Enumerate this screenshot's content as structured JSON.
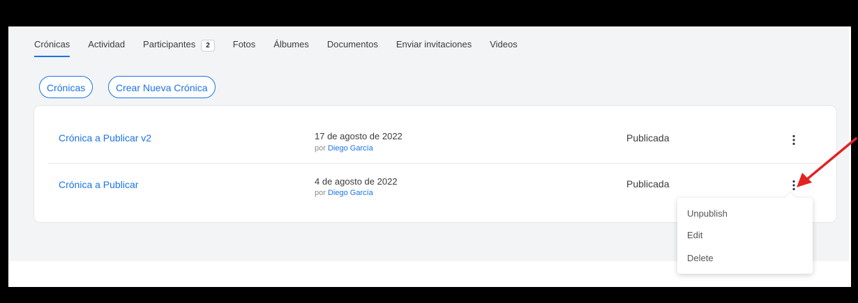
{
  "tabs": [
    {
      "label": "Crónicas"
    },
    {
      "label": "Actividad"
    },
    {
      "label": "Participantes",
      "count": "2"
    },
    {
      "label": "Fotos"
    },
    {
      "label": "Álbumes"
    },
    {
      "label": "Documentos"
    },
    {
      "label": "Enviar invitaciones"
    },
    {
      "label": "Videos"
    }
  ],
  "actions": {
    "list_label": "Crónicas",
    "create_label": "Crear Nueva Crónica"
  },
  "items": [
    {
      "title": "Crónica a Publicar v2",
      "date": "17 de agosto de 2022",
      "by_prefix": "por",
      "author": "Diego García",
      "status": "Publicada"
    },
    {
      "title": "Crónica a Publicar",
      "date": "4 de agosto de 2022",
      "by_prefix": "por",
      "author": "Diego García",
      "status": "Publicada"
    }
  ],
  "menu": {
    "items": [
      "Unpublish",
      "Edit",
      "Delete"
    ]
  },
  "colors": {
    "accent": "#1a73e8",
    "annotation_arrow": "#e32222"
  },
  "icons": [
    "more-vertical-icon",
    "annotation-arrow-icon"
  ]
}
